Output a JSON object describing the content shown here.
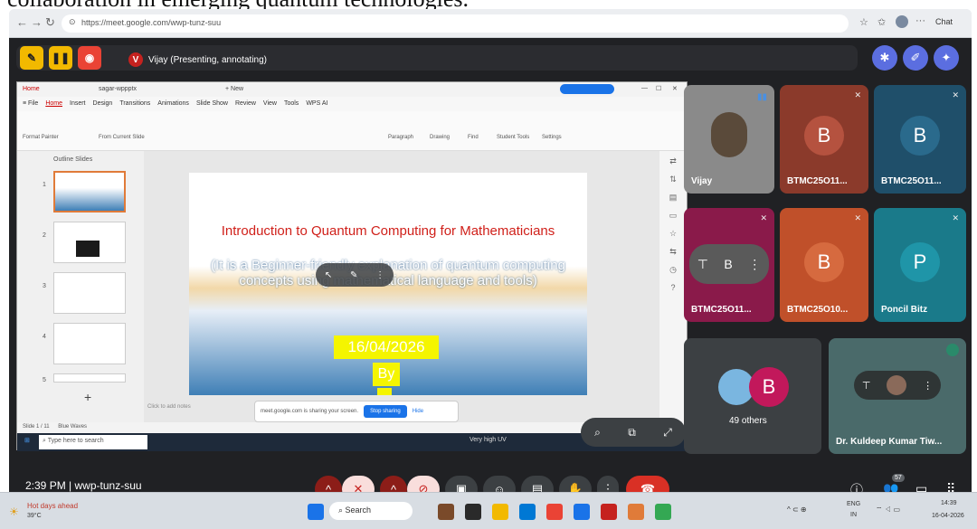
{
  "caption": "collaboration in emerging quantum technologies.",
  "browser": {
    "url": "https://meet.google.com/wwp-tunz-suu",
    "chat_label": "Chat"
  },
  "meet": {
    "presenter_initial": "V",
    "presenter_label": "Vijay (Presenting, annotating)",
    "time": "2:39 PM",
    "separator": "|",
    "meeting_code": "wwp-tunz-suu",
    "people_count": "57"
  },
  "ppt": {
    "tab_home": "Home",
    "tab_file": "sagar-wppptx",
    "tab_new": "+ New",
    "menu": [
      "Home",
      "Insert",
      "Design",
      "Transitions",
      "Animations",
      "Slide Show",
      "Review",
      "View",
      "Tools",
      "WPS AI"
    ],
    "ribbon": [
      "Format Painter",
      "From Current Slide",
      "Paragraph",
      "Drawing",
      "Find",
      "Student Tools",
      "Settings"
    ],
    "outline_tabs": "Outline  Slides",
    "slide_numbers": [
      "1",
      "2",
      "3",
      "4",
      "5"
    ],
    "notes": "Click to add notes",
    "status": "Slide 1 / 11",
    "theme": "Blue Waves",
    "share_text": "meet.google.com is sharing your screen.",
    "stop_label": "Stop sharing",
    "hide_label": "Hide"
  },
  "slide": {
    "title": "Introduction to Quantum Computing for Mathematicians",
    "subtitle": "(It is a Beginner-friendly explanation of quantum computing concepts using mathematical language and tools)",
    "date": "16/04/2026",
    "by": "By"
  },
  "wintask": {
    "search_placeholder": "Type here to search",
    "weather": "Very high UV"
  },
  "participants": [
    {
      "name": "Vijay",
      "initial": "",
      "color": "#9a9a9a"
    },
    {
      "name": "BTMC25O11...",
      "initial": "B",
      "color": "#8b3a2b"
    },
    {
      "name": "BTMC25O11...",
      "initial": "B",
      "color": "#1f4f6a"
    },
    {
      "name": "BTMC25O11...",
      "initial": "B",
      "color": "#8a1a4a"
    },
    {
      "name": "BTMC25O10...",
      "initial": "B",
      "color": "#c0502a"
    },
    {
      "name": "Poncil Bitz",
      "initial": "P",
      "color": "#1a7a8a"
    }
  ],
  "others": {
    "count_label": "49 others",
    "initial": "B"
  },
  "kuldeep": {
    "name": "Dr. Kuldeep Kumar Tiw..."
  },
  "taskbar": {
    "weather_title": "Hot days ahead",
    "weather_temp": "39°C",
    "search_label": "Search",
    "lang": "ENG",
    "region": "IN",
    "clock_time": "14:39",
    "clock_date": "16-04-2026"
  },
  "colors": {
    "meet_bg": "#202124",
    "accent_blue": "#1a73e8",
    "end_call": "#d93025"
  }
}
